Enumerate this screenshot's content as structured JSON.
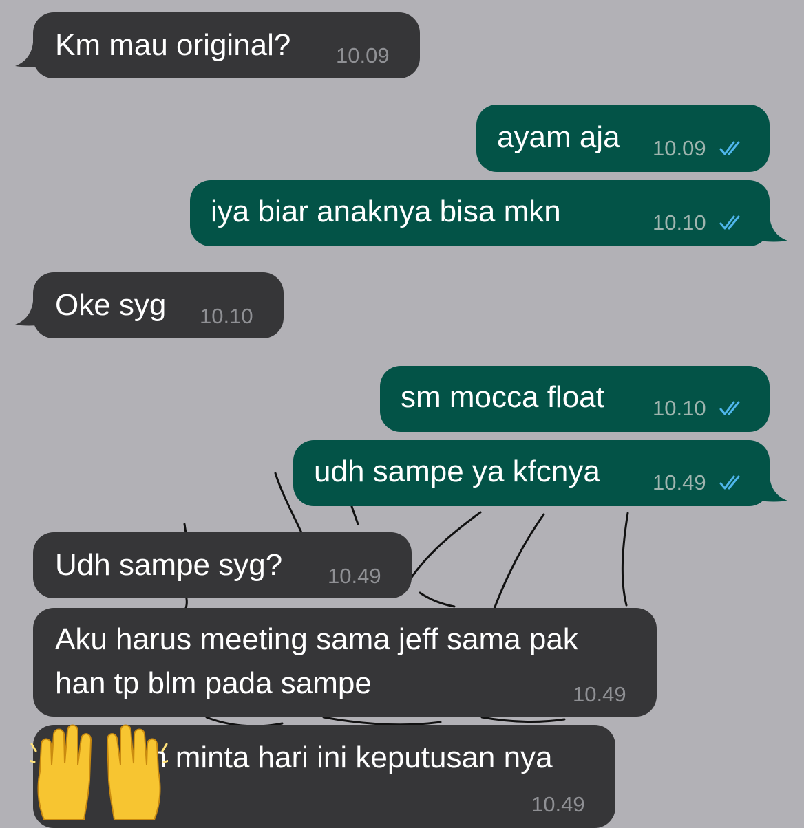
{
  "theme": {
    "background": "#b2b1b6",
    "incoming_bubble": "#363638",
    "outgoing_bubble": "#035347",
    "text_color": "#ffffff",
    "time_color_in": "#8f9094",
    "time_color_out": "#9fb4ae",
    "read_tick_color": "#4fb6ec"
  },
  "messages": [
    {
      "direction": "incoming",
      "text": "Km mau original?",
      "time": "10.09"
    },
    {
      "direction": "outgoing",
      "text": "ayam aja",
      "time": "10.09",
      "status_icon": "double-check-icon"
    },
    {
      "direction": "outgoing",
      "text": "iya biar anaknya bisa mkn",
      "time": "10.10",
      "status_icon": "double-check-icon"
    },
    {
      "direction": "incoming",
      "text": "Oke syg",
      "time": "10.10"
    },
    {
      "direction": "outgoing",
      "text": "sm mocca float",
      "time": "10.10",
      "status_icon": "double-check-icon"
    },
    {
      "direction": "outgoing",
      "text": "udh sampe ya kfcnya",
      "time": "10.49",
      "status_icon": "double-check-icon"
    },
    {
      "direction": "incoming",
      "text": "Udh sampe syg?",
      "time": "10.49"
    },
    {
      "direction": "incoming",
      "text_lines": [
        "Aku harus meeting sama jeff sama pak",
        "han tp blm pada sampe"
      ],
      "time": "10.49"
    },
    {
      "direction": "incoming",
      "text": "n minta hari ini keputusan nya",
      "time": "10.49",
      "overlay_icon": "raising-hands-emoji-icon"
    }
  ]
}
